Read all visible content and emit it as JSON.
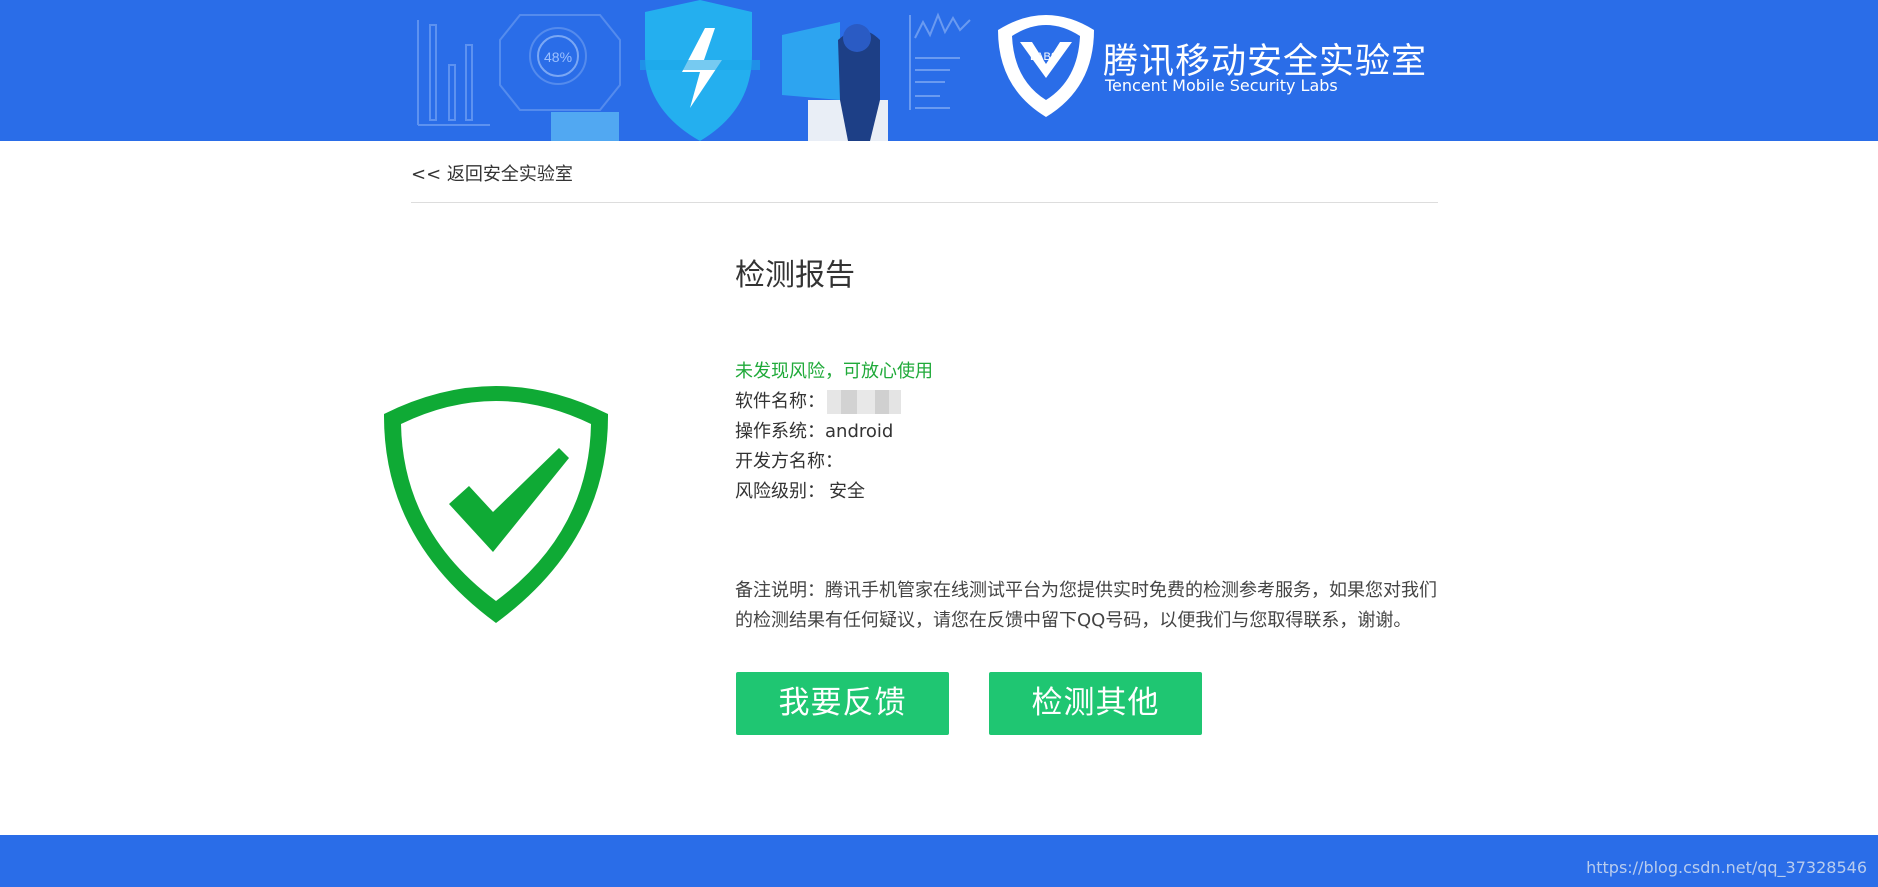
{
  "header": {
    "title": "腾讯移动安全实验室",
    "subtitle": "Tencent Mobile Security Labs",
    "logo_badge": "LABS",
    "gauge_text": "48%",
    "banner_color": "#2a6de8"
  },
  "nav": {
    "back_link": "<< 返回安全实验室"
  },
  "report": {
    "title": "检测报告",
    "status": "未发现风险，可放心使用",
    "status_color": "#20aa3a",
    "software_name_label": "软件名称：",
    "software_name_value": "",
    "os_label": "操作系统：",
    "os_value": "android",
    "developer_label": "开发方名称：",
    "developer_value": "",
    "risk_label": "风险级别：",
    "risk_value": "安全",
    "shield_icon": "shield-check-icon",
    "note": "备注说明：腾讯手机管家在线测试平台为您提供实时免费的检测参考服务，如果您对我们的检测结果有任何疑议，请您在反馈中留下QQ号码，以便我们与您取得联系，谢谢。"
  },
  "actions": {
    "feedback_label": "我要反馈",
    "check_other_label": "检测其他",
    "button_color": "#1fc672"
  },
  "footer": {
    "watermark": "https://blog.csdn.net/qq_37328546"
  }
}
